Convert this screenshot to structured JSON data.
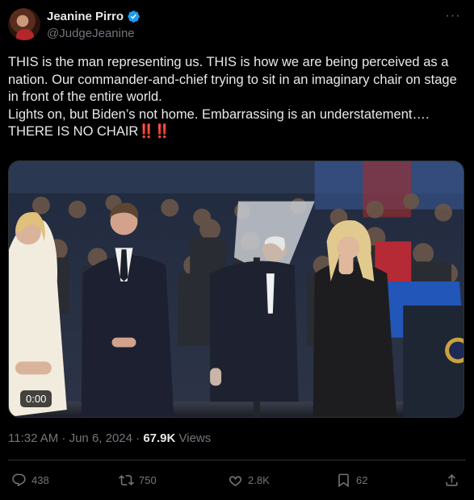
{
  "author": {
    "display_name": "Jeanine Pirro",
    "handle": "@JudgeJeanine",
    "verified": true
  },
  "tweet": {
    "text_main": "THIS is the man representing us. THIS is how we are being perceived as a nation. Our commander-and-chief trying to sit in an imaginary chair on stage in front of the entire world.\nLights on, but Biden’s not home. Embarrassing is an understatement….\nTHERE IS NO CHAIR",
    "emoji": "‼️‼️"
  },
  "media": {
    "video_time": "0:00"
  },
  "meta": {
    "timestamp": "11:32 AM · Jun 6, 2024 · ",
    "views_count": "67.9K",
    "views_label": " Views"
  },
  "actions": {
    "replies": "438",
    "reposts": "750",
    "likes": "2.8K",
    "bookmarks": "62"
  },
  "colors": {
    "background": "#000000",
    "text": "#e7e9ea",
    "muted": "#71767b",
    "verified": "#1d9bf0",
    "divider": "#2f3336"
  }
}
